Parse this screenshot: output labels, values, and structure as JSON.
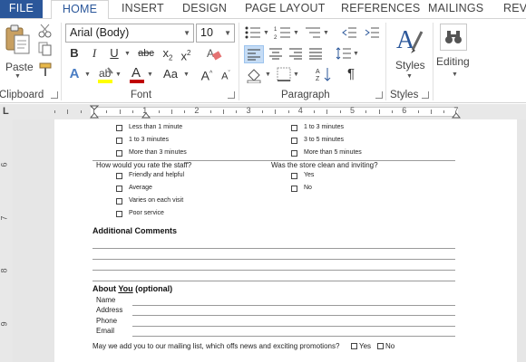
{
  "tabs": [
    "FILE",
    "HOME",
    "INSERT",
    "DESIGN",
    "PAGE LAYOUT",
    "REFERENCES",
    "MAILINGS",
    "REVI"
  ],
  "clipboard": {
    "paste_label": "Paste",
    "group_label": "Clipboard"
  },
  "font": {
    "name": "Arial (Body)",
    "size": "10",
    "group_label": "Font",
    "case_label": "Aa"
  },
  "paragraph": {
    "group_label": "Paragraph"
  },
  "styles": {
    "label": "Styles",
    "group_label": "Styles"
  },
  "editing": {
    "label": "Editing"
  },
  "ruler": {
    "numbers": [
      "1",
      "2",
      "3",
      "4",
      "5",
      "6",
      "7"
    ],
    "vertical_numbers": [
      "6",
      "7",
      "8",
      "9"
    ]
  },
  "colors": {
    "accent": "#2b579a",
    "highlight": "#ffff00",
    "font_color": "#c00000"
  },
  "document": {
    "top_left_options": [
      "Less than 1 minute",
      "1 to 3 minutes",
      "More than 3 minutes"
    ],
    "top_right_options": [
      "1 to 3 minutes",
      "3 to 5 minutes",
      "More than 5 minutes"
    ],
    "q_staff": "How would you rate the staff?",
    "q_store": "Was the store clean and inviting?",
    "staff_options": [
      "Friendly and helpful",
      "Average",
      "Varies on each visit",
      "Poor service"
    ],
    "store_options": [
      "Yes",
      "No"
    ],
    "additional_comments": "Additional Comments",
    "about_you_prefix": "About ",
    "about_you_underlined": "You",
    "about_you_suffix": " (optional)",
    "fields": [
      "Name",
      "Address",
      "Phone",
      "Email"
    ],
    "mailing_question": "May we add you to our mailing list, which offs news and exciting promotions?",
    "mailing_yes": "Yes",
    "mailing_no": "No"
  }
}
